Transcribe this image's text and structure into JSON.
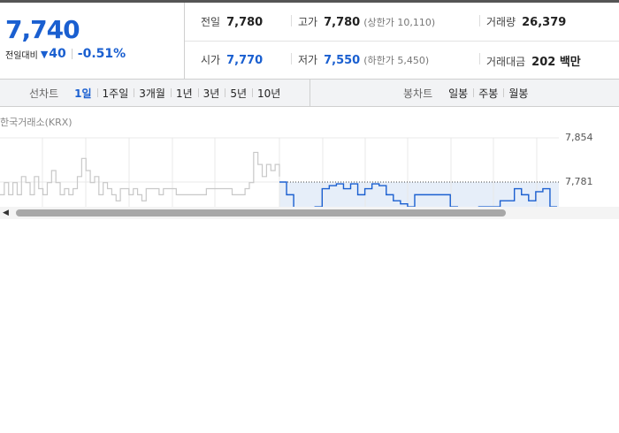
{
  "price": {
    "current": "7,740",
    "change_label": "전일대비",
    "change_arrow": "▼",
    "change_amount": "40",
    "change_pct": "-0.51%"
  },
  "stats": {
    "prev_label": "전일",
    "prev_value": "7,780",
    "high_label": "고가",
    "high_value": "7,780",
    "high_limit": "(상한가 10,110)",
    "volume_label": "거래량",
    "volume_value": "26,379",
    "open_label": "시가",
    "open_value": "7,770",
    "low_label": "저가",
    "low_value": "7,550",
    "low_limit": "(하한가 5,450)",
    "amount_label": "거래대금",
    "amount_value": "202 백만"
  },
  "tabs": {
    "line_title": "선차트",
    "line_tabs": [
      "1일",
      "1주일",
      "3개월",
      "1년",
      "3년",
      "5년",
      "10년"
    ],
    "line_active": "1일",
    "candle_title": "봉차트",
    "candle_tabs": [
      "일봉",
      "주봉",
      "월봉"
    ]
  },
  "exchange": "한국거래소(KRX)",
  "colors": {
    "accent": "#1a5fd0",
    "prev_line": "#c8c8c8",
    "fill": "#e6eef9"
  },
  "chart_data": {
    "type": "line",
    "y_ticks": [
      "7,854",
      "7,781"
    ],
    "reference_value": 7781,
    "series": [
      {
        "values": [
          7760,
          7780,
          7760,
          7780,
          7760,
          7790,
          7780,
          7760,
          7790,
          7770,
          7760,
          7780,
          7800,
          7780,
          7760,
          7770,
          7760,
          7770,
          7790,
          7820,
          7800,
          7780,
          7790,
          7760,
          7780,
          7770,
          7760,
          7750,
          7770,
          7770,
          7760,
          7770,
          7760,
          7750,
          7770,
          7770,
          7770,
          7760,
          7770,
          7770,
          7770,
          7760,
          7760,
          7760,
          7760,
          7760,
          7760,
          7760,
          7770,
          7770,
          7770,
          7770,
          7770,
          7770,
          7760,
          7760,
          7760,
          7770,
          7780,
          7830,
          7810,
          7790,
          7810,
          7800,
          7810,
          7790
        ]
      },
      {
        "values": [
          7781,
          7760,
          7700,
          7720,
          7690,
          7740,
          7770,
          7775,
          7778,
          7770,
          7778,
          7760,
          7770,
          7778,
          7775,
          7760,
          7750,
          7745,
          7740,
          7760,
          7760,
          7760,
          7760,
          7760,
          7740,
          7730,
          7730,
          7735,
          7740,
          7740,
          7740,
          7750,
          7750,
          7770,
          7760,
          7750,
          7765,
          7770,
          7740,
          7740
        ]
      }
    ]
  }
}
